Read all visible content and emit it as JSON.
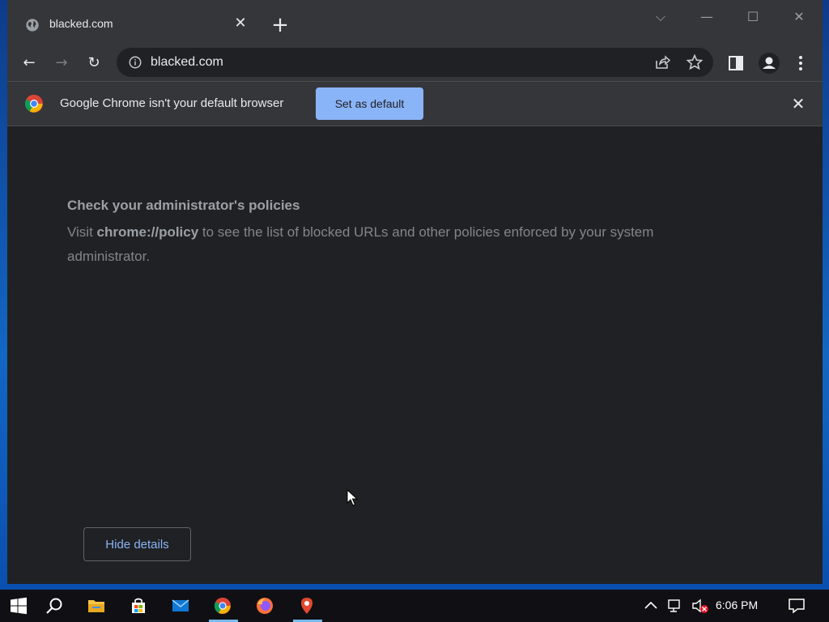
{
  "browser": {
    "tab": {
      "title": "blacked.com",
      "close": "✕"
    },
    "new_tab": "+",
    "window_controls": {
      "tabsearch": "⌵",
      "minimize": "—",
      "maximize": "☐",
      "close": "✕"
    },
    "toolbar": {
      "back": "←",
      "forward": "→",
      "reload": "↻",
      "url": "blacked.com"
    }
  },
  "infobar": {
    "message": "Google Chrome isn't your default browser",
    "button": "Set as default",
    "close": "✕"
  },
  "content": {
    "heading": "Check your administrator's policies",
    "body_prefix": "Visit ",
    "body_link": "chrome://policy",
    "body_suffix": " to see the list of blocked URLs and other policies enforced by your system administrator.",
    "hide_details": "Hide details"
  },
  "taskbar": {
    "clock": "6:06 PM",
    "apps": [
      "start-icon",
      "search-icon",
      "file-explorer-icon",
      "microsoft-store-icon",
      "mail-icon",
      "chrome-icon",
      "firefox-icon",
      "maps-pin-icon"
    ]
  },
  "colors": {
    "accent": "#8ab4f8",
    "surface": "#202124",
    "toolbar": "#35363a"
  }
}
